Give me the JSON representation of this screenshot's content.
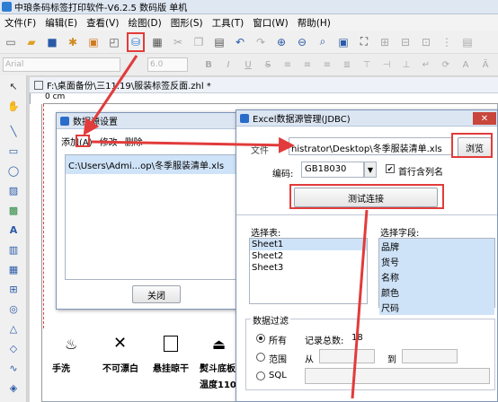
{
  "app": {
    "title": "中琅条码标签打印软件-V6.2.5 数码版 单机"
  },
  "menu": [
    "文件(F)",
    "编辑(E)",
    "查看(V)",
    "绘图(D)",
    "图形(S)",
    "工具(T)",
    "窗口(W)",
    "帮助(H)"
  ],
  "font": {
    "name": "Arial",
    "size": "6.0"
  },
  "document": {
    "tab_title": "F:\\桌面备份\\三11.19\\服装标签反面.zhl *",
    "ruler_label": "0 cm"
  },
  "datasource_dialog": {
    "title": "数据源设置",
    "add": "添加(A)",
    "modify": "修改",
    "delete": "删除",
    "entry": "C:\\Users\\Admi...op\\冬季服装清单.xls",
    "close": "关闭"
  },
  "excel_dialog": {
    "title": "Excel数据源管理(JDBC)",
    "file_label": "文件",
    "file_path": "nistrator\\Desktop\\冬季服装清单.xls",
    "browse": "浏览",
    "encoding_label": "编码:",
    "encoding_value": "GB18030",
    "first_row_label": "首行含列名",
    "test_button": "测试连接",
    "tables_label": "选择表:",
    "tables": [
      "Sheet1",
      "Sheet2",
      "Sheet3"
    ],
    "fields_label": "选择字段:",
    "fields": [
      "品牌",
      "货号",
      "名称",
      "颜色",
      "尺码"
    ],
    "filter_label": "数据过滤",
    "opt_all": "所有",
    "record_count_label": "记录总数:",
    "record_count": "18",
    "opt_range": "范围",
    "from_label": "从",
    "to_label": "到",
    "opt_sql": "SQL"
  },
  "symbols": [
    {
      "label": "手洗"
    },
    {
      "label": "不可漂白"
    },
    {
      "label": "悬挂晾干"
    },
    {
      "label": "熨斗底板"
    }
  ],
  "partial_text": "温度110",
  "colors": {
    "annotation": "#e23b3b",
    "titlebar": "#dce6f3",
    "selection": "#cfe3f8"
  }
}
